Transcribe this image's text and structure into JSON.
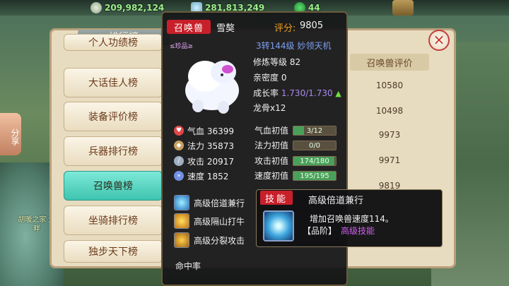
{
  "currency": {
    "silver": "209,982,124",
    "crystal": "281,813,249",
    "jade": "44"
  },
  "top_button": "",
  "share_label": "分享",
  "side_note": "胡暖之家\n湖畔",
  "ranking": {
    "title": "排行榜",
    "categories": [
      "个人功绩榜",
      "大话佳人榜",
      "装备评价榜",
      "兵器排行榜",
      "召唤兽榜",
      "坐骑排行榜",
      "独步天下榜"
    ],
    "active_category": "召唤兽榜",
    "score_header": "召唤兽评价",
    "scores": [
      "10580",
      "10498",
      "9973",
      "9971",
      "9819"
    ]
  },
  "pet": {
    "tag": "召唤兽",
    "name": "雪獒",
    "score_label": "评分:",
    "score": "9805",
    "grade": "≤珍品≥",
    "location_level": "3转144级",
    "location_name": "妙领天机",
    "cultivation": "修炼等级 82",
    "intimacy": "亲密度 0",
    "growth_label": "成长率",
    "growth_value": "1.730/1.730",
    "dragon_bone": "龙骨x12",
    "attributes": [
      {
        "label": "气血 36399",
        "icon": "heart-icon",
        "color": "#e04848"
      },
      {
        "label": "法力 35873",
        "icon": "mana-icon",
        "color": "#c8a060"
      },
      {
        "label": "攻击 20917",
        "icon": "sword-icon",
        "color": "#a0b0c0"
      },
      {
        "label": "速度 1852",
        "icon": "speed-icon",
        "color": "#7090e0"
      }
    ],
    "aptitudes": [
      {
        "label": "气血初值",
        "value": "3/12",
        "fill": 0.25
      },
      {
        "label": "法力初值",
        "value": "0/0",
        "fill": 0
      },
      {
        "label": "攻击初值",
        "value": "174/180",
        "fill": 0.967
      },
      {
        "label": "速度初值",
        "value": "195/195",
        "fill": 1.0
      }
    ],
    "skills": [
      "高级倍道兼行",
      "高级隔山打牛",
      "高级分裂攻击"
    ],
    "more_line": "命中率"
  },
  "skill_tip": {
    "tag": "技能",
    "name": "高级倍道兼行",
    "desc": "增加召唤兽速度114。",
    "quality_label": "【品阶】",
    "quality_value": "高级技能"
  }
}
